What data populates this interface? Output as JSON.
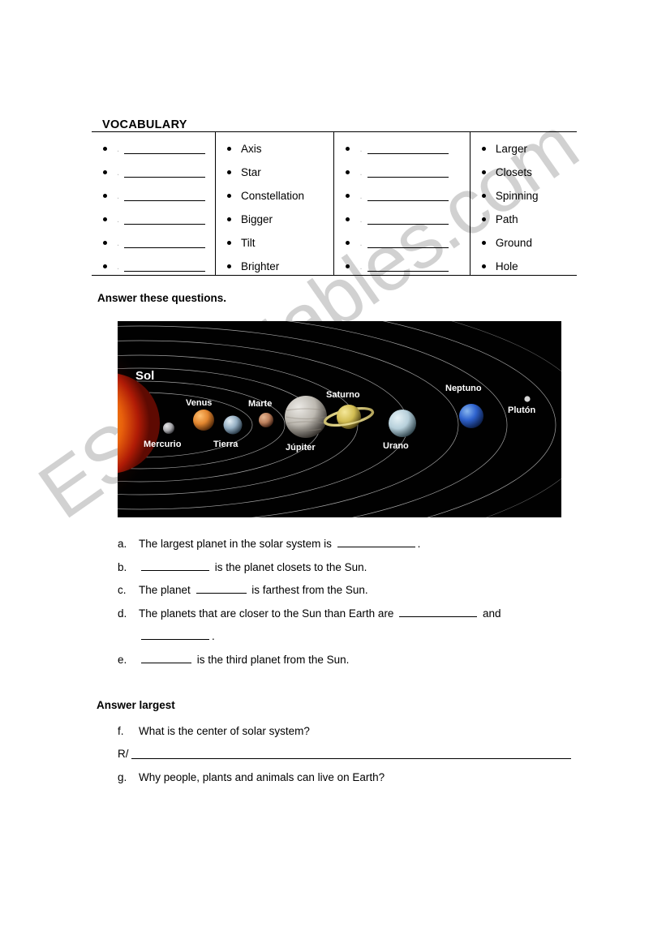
{
  "worksheet": {
    "vocabulary_heading": "VOCABULARY",
    "answer_questions_heading": "Answer these questions.",
    "answer_largest_heading": "Answer largest"
  },
  "watermark": {
    "text": "ESLprintables.com",
    "color": "#c8c8c8"
  },
  "vocabulary_table": {
    "columns": [
      {
        "type": "blanks",
        "items": [
          {
            "label": "",
            "blank": true
          },
          {
            "label": "",
            "blank": true
          },
          {
            "label": "",
            "blank": true
          },
          {
            "label": "",
            "blank": true
          },
          {
            "label": "",
            "blank": true
          },
          {
            "label": "",
            "blank": true
          }
        ]
      },
      {
        "type": "words",
        "items": [
          {
            "label": "Axis",
            "blank": false
          },
          {
            "label": "Star",
            "blank": false
          },
          {
            "label": "Constellation",
            "blank": false
          },
          {
            "label": "Bigger",
            "blank": false
          },
          {
            "label": "Tilt",
            "blank": false
          },
          {
            "label": "Brighter",
            "blank": false
          }
        ]
      },
      {
        "type": "blanks",
        "items": [
          {
            "label": "",
            "blank": true
          },
          {
            "label": "",
            "blank": true
          },
          {
            "label": "",
            "blank": true
          },
          {
            "label": "",
            "blank": true
          },
          {
            "label": "",
            "blank": true
          },
          {
            "label": "",
            "blank": true
          }
        ]
      },
      {
        "type": "words",
        "items": [
          {
            "label": "Larger",
            "blank": false
          },
          {
            "label": "Closets",
            "blank": false
          },
          {
            "label": "Spinning",
            "blank": false
          },
          {
            "label": "Path",
            "blank": false
          },
          {
            "label": "Ground",
            "blank": false
          },
          {
            "label": "Hole",
            "blank": false
          }
        ]
      }
    ]
  },
  "solar_system_figure": {
    "caption_language": "es",
    "background_color": "#010101",
    "bodies": [
      {
        "name": "Sol",
        "label": "Sol",
        "color": "#f07a10",
        "type": "star"
      },
      {
        "name": "Mercurio",
        "label": "Mercurio",
        "color": "#b9b9bb",
        "type": "planet"
      },
      {
        "name": "Venus",
        "label": "Venus",
        "color": "#e08a38",
        "type": "planet"
      },
      {
        "name": "Tierra",
        "label": "Tierra",
        "color": "#9fb6c8",
        "type": "planet"
      },
      {
        "name": "Marte",
        "label": "Marte",
        "color": "#c08a6a",
        "type": "planet"
      },
      {
        "name": "Jupiter",
        "label": "Júpiter",
        "color": "#c3c0ba",
        "type": "planet"
      },
      {
        "name": "Saturno",
        "label": "Saturno",
        "color": "#d8c86a",
        "type": "planet"
      },
      {
        "name": "Urano",
        "label": "Urano",
        "color": "#c3d6de",
        "type": "planet"
      },
      {
        "name": "Neptuno",
        "label": "Neptuno",
        "color": "#3a6ed0",
        "type": "planet"
      },
      {
        "name": "Pluton",
        "label": "Plutón",
        "color": "#cfcfcf",
        "type": "planet"
      }
    ]
  },
  "questions_main": [
    {
      "marker": "a.",
      "parts": [
        {
          "kind": "text",
          "value": "The largest planet in the solar system is "
        },
        {
          "kind": "blank",
          "width": "long"
        },
        {
          "kind": "text",
          "value": "."
        }
      ]
    },
    {
      "marker": "b.",
      "parts": [
        {
          "kind": "blank",
          "width": "med"
        },
        {
          "kind": "text",
          "value": " is the planet closets to the Sun."
        }
      ]
    },
    {
      "marker": "c.",
      "parts": [
        {
          "kind": "text",
          "value": "The planet "
        },
        {
          "kind": "blank",
          "width": "short"
        },
        {
          "kind": "text",
          "value": " is farthest from the Sun."
        }
      ]
    },
    {
      "marker": "d.",
      "parts": [
        {
          "kind": "text",
          "value": "The planets that are closer to the Sun than Earth are "
        },
        {
          "kind": "blank",
          "width": "long"
        },
        {
          "kind": "text",
          "value": " and"
        }
      ],
      "continuation": [
        {
          "kind": "blank",
          "width": "med"
        },
        {
          "kind": "text",
          "value": "."
        }
      ]
    },
    {
      "marker": "e.",
      "parts": [
        {
          "kind": "blank",
          "width": "short"
        },
        {
          "kind": "text",
          "value": " is the third planet from the Sun."
        }
      ]
    }
  ],
  "questions_open": [
    {
      "marker": "f.",
      "text": "What is the center of solar system?"
    },
    {
      "marker": "g.",
      "text": "Why people, plants and animals can live on Earth?"
    }
  ],
  "answer_line": {
    "label": "R/"
  }
}
